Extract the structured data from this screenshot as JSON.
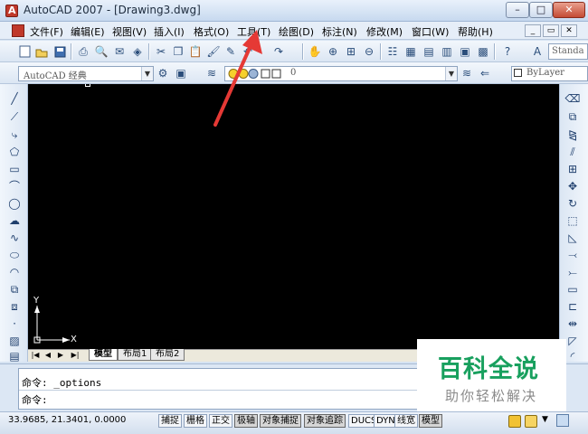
{
  "window": {
    "title": "AutoCAD 2007 - [Drawing3.dwg]",
    "controls": [
      "–",
      "□",
      "✕"
    ]
  },
  "menu": {
    "items": [
      "文件(F)",
      "编辑(E)",
      "视图(V)",
      "插入(I)",
      "格式(O)",
      "工具(T)",
      "绘图(D)",
      "标注(N)",
      "修改(M)",
      "窗口(W)",
      "帮助(H)"
    ],
    "mdi_controls": [
      "_",
      "▭",
      "✕"
    ]
  },
  "toolbar": {
    "text_style": "Standa",
    "workspace": "AutoCAD 经典",
    "layer": "0",
    "color": "ByLayer"
  },
  "canvas": {
    "ucs_x": "X",
    "ucs_y": "Y"
  },
  "tabs": {
    "nav": [
      "|◀",
      "◀",
      "▶",
      "▶|"
    ],
    "items": [
      "模型",
      "布局1",
      "布局2"
    ]
  },
  "command": {
    "line1": "命令: _options",
    "line2": "命令:"
  },
  "status": {
    "coords": "33.9685, 21.3401, 0.0000",
    "buttons": [
      {
        "label": "捕捉",
        "on": false
      },
      {
        "label": "栅格",
        "on": false
      },
      {
        "label": "正交",
        "on": false
      },
      {
        "label": "极轴",
        "on": true
      },
      {
        "label": "对象捕捉",
        "on": true
      },
      {
        "label": "对象追踪",
        "on": true
      },
      {
        "label": "DUCS",
        "on": false
      },
      {
        "label": "DYN",
        "on": false
      },
      {
        "label": "线宽",
        "on": false
      },
      {
        "label": "模型",
        "on": true
      }
    ]
  },
  "watermark": {
    "title": "百科全说",
    "subtitle": "助你轻松解决"
  },
  "colors": {
    "canvas": "#000000",
    "annotation_arrow": "#e53935",
    "watermark_green": "#18a05e"
  }
}
